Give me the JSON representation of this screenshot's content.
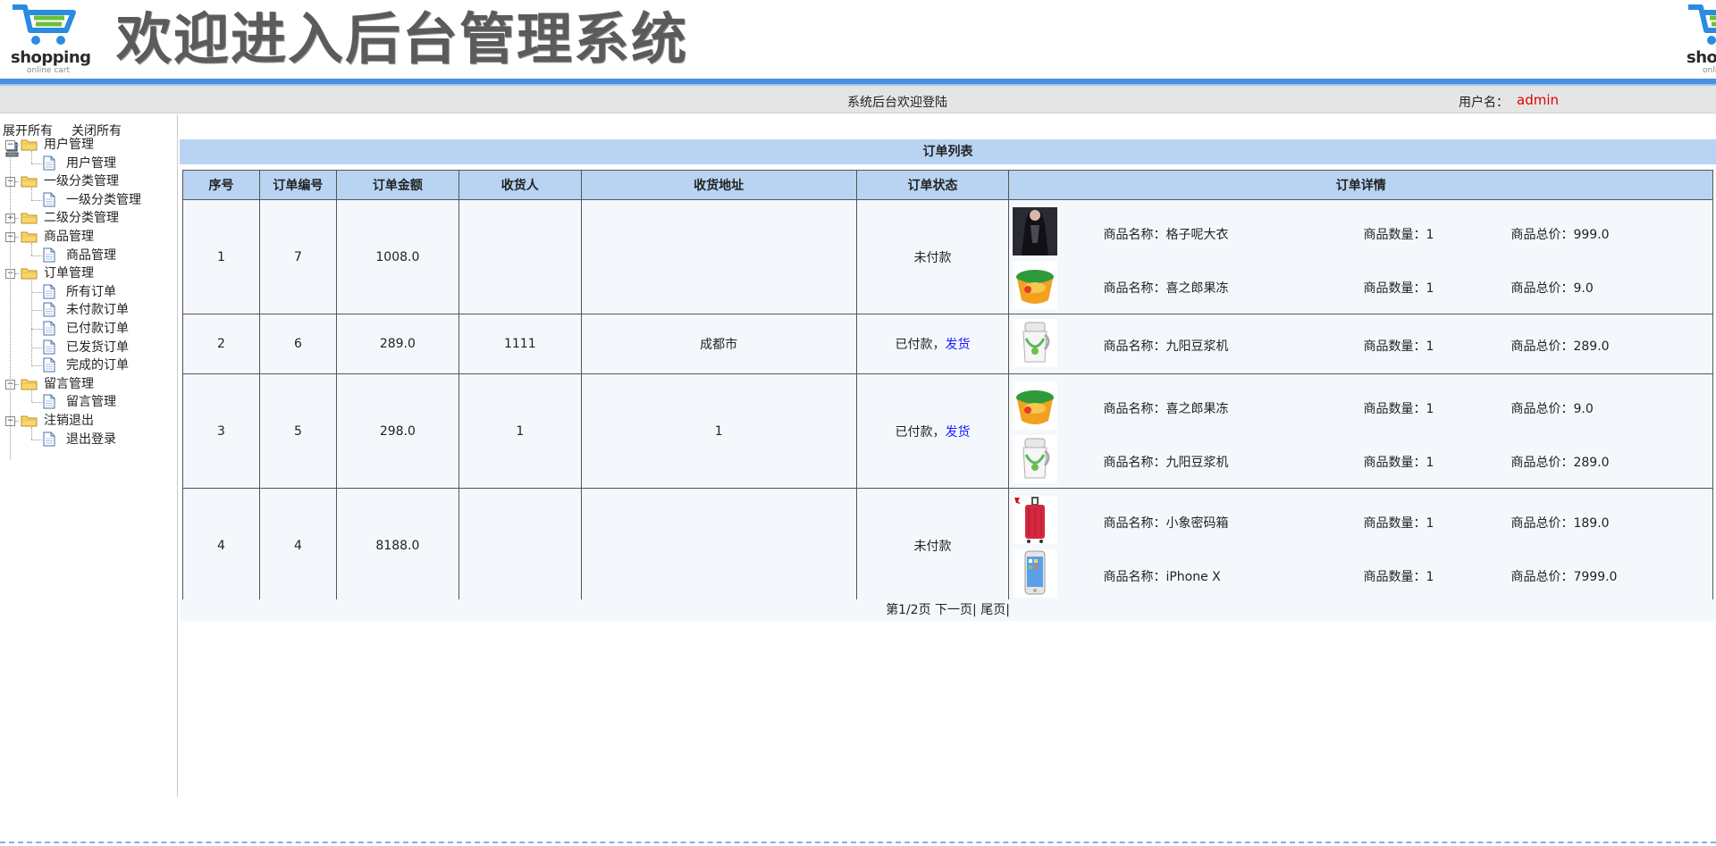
{
  "header": {
    "logo_brand": "shopping",
    "logo_tagline": "online cart",
    "site_title": "欢迎进入后台管理系统"
  },
  "topbar": {
    "welcome": "系统后台欢迎登陆",
    "user_label": "用户名：",
    "user_name": "admin"
  },
  "sidebar": {
    "expand_all": "展开所有",
    "collapse_all": "关闭所有",
    "groups": [
      {
        "label": "用户管理",
        "toggle": "−",
        "children": [
          "用户管理"
        ]
      },
      {
        "label": "一级分类管理",
        "toggle": "−",
        "children": [
          "一级分类管理"
        ]
      },
      {
        "label": "二级分类管理",
        "toggle": "+",
        "children": []
      },
      {
        "label": "商品管理",
        "toggle": "−",
        "children": [
          "商品管理"
        ]
      },
      {
        "label": "订单管理",
        "toggle": "−",
        "children": [
          "所有订单",
          "未付款订单",
          "已付款订单",
          "已发货订单",
          "完成的订单"
        ]
      },
      {
        "label": "留言管理",
        "toggle": "−",
        "children": [
          "留言管理"
        ]
      },
      {
        "label": "注销退出",
        "toggle": "−",
        "children": [
          "退出登录"
        ]
      }
    ]
  },
  "main": {
    "list_title": "订单列表",
    "columns": [
      "序号",
      "订单编号",
      "订单金额",
      "收货人",
      "收货地址",
      "订单状态",
      "订单详情"
    ],
    "detail_labels": {
      "name": "商品名称：",
      "qty": "商品数量：",
      "total": "商品总价："
    },
    "orders": [
      {
        "index": "1",
        "order_no": "7",
        "amount": "1008.0",
        "receiver": "",
        "address": "",
        "status": "未付款",
        "action": "",
        "items": [
          {
            "name": "格子呢大衣",
            "qty": "1",
            "total": "999.0",
            "thumb": "coat-photo"
          },
          {
            "name": "喜之郎果冻",
            "qty": "1",
            "total": "9.0",
            "thumb": "jelly-photo"
          }
        ]
      },
      {
        "index": "2",
        "order_no": "6",
        "amount": "289.0",
        "receiver": "1111",
        "address": "成都市",
        "status": "已付款，",
        "action": "发货",
        "items": [
          {
            "name": "九阳豆浆机",
            "qty": "1",
            "total": "289.0",
            "thumb": "soymilk-maker-photo"
          }
        ]
      },
      {
        "index": "3",
        "order_no": "5",
        "amount": "298.0",
        "receiver": "1",
        "address": "1",
        "status": "已付款，",
        "action": "发货",
        "items": [
          {
            "name": "喜之郎果冻",
            "qty": "1",
            "total": "9.0",
            "thumb": "jelly-photo"
          },
          {
            "name": "九阳豆浆机",
            "qty": "1",
            "total": "289.0",
            "thumb": "soymilk-maker-photo"
          }
        ]
      },
      {
        "index": "4",
        "order_no": "4",
        "amount": "8188.0",
        "receiver": "",
        "address": "",
        "status": "未付款",
        "action": "",
        "items": [
          {
            "name": "小象密码箱",
            "qty": "1",
            "total": "189.0",
            "thumb": "suitcase-photo"
          },
          {
            "name": "iPhone X",
            "qty": "1",
            "total": "7999.0",
            "thumb": "iphone-photo"
          }
        ]
      }
    ],
    "pager": {
      "page_info": "第1/2页",
      "next": "下一页",
      "sep1": "|",
      "last": "尾页",
      "sep2": "|"
    }
  },
  "colors": {
    "accent_blue": "#4a90e2",
    "header_blue": "#b8d4f2",
    "username_red": "#e00000",
    "link_blue": "#1a1aff"
  }
}
